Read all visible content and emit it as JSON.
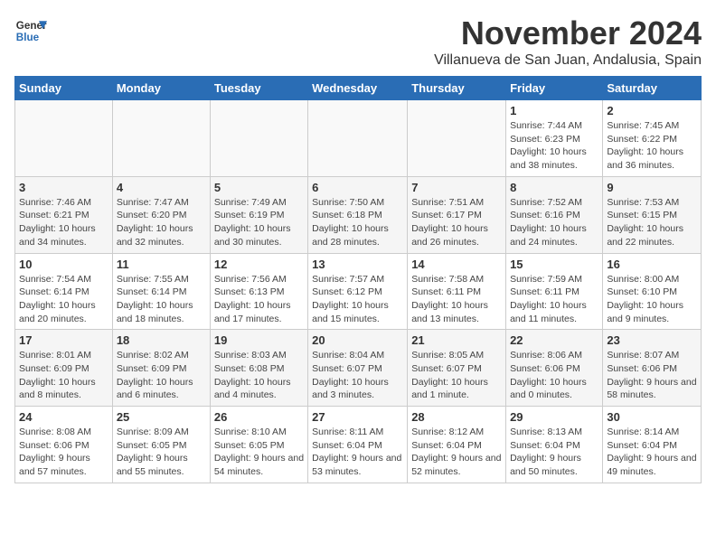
{
  "logo": {
    "line1": "General",
    "line2": "Blue"
  },
  "title": "November 2024",
  "subtitle": "Villanueva de San Juan, Andalusia, Spain",
  "columns": [
    "Sunday",
    "Monday",
    "Tuesday",
    "Wednesday",
    "Thursday",
    "Friday",
    "Saturday"
  ],
  "weeks": [
    [
      {
        "day": "",
        "info": ""
      },
      {
        "day": "",
        "info": ""
      },
      {
        "day": "",
        "info": ""
      },
      {
        "day": "",
        "info": ""
      },
      {
        "day": "",
        "info": ""
      },
      {
        "day": "1",
        "info": "Sunrise: 7:44 AM\nSunset: 6:23 PM\nDaylight: 10 hours and 38 minutes."
      },
      {
        "day": "2",
        "info": "Sunrise: 7:45 AM\nSunset: 6:22 PM\nDaylight: 10 hours and 36 minutes."
      }
    ],
    [
      {
        "day": "3",
        "info": "Sunrise: 7:46 AM\nSunset: 6:21 PM\nDaylight: 10 hours and 34 minutes."
      },
      {
        "day": "4",
        "info": "Sunrise: 7:47 AM\nSunset: 6:20 PM\nDaylight: 10 hours and 32 minutes."
      },
      {
        "day": "5",
        "info": "Sunrise: 7:49 AM\nSunset: 6:19 PM\nDaylight: 10 hours and 30 minutes."
      },
      {
        "day": "6",
        "info": "Sunrise: 7:50 AM\nSunset: 6:18 PM\nDaylight: 10 hours and 28 minutes."
      },
      {
        "day": "7",
        "info": "Sunrise: 7:51 AM\nSunset: 6:17 PM\nDaylight: 10 hours and 26 minutes."
      },
      {
        "day": "8",
        "info": "Sunrise: 7:52 AM\nSunset: 6:16 PM\nDaylight: 10 hours and 24 minutes."
      },
      {
        "day": "9",
        "info": "Sunrise: 7:53 AM\nSunset: 6:15 PM\nDaylight: 10 hours and 22 minutes."
      }
    ],
    [
      {
        "day": "10",
        "info": "Sunrise: 7:54 AM\nSunset: 6:14 PM\nDaylight: 10 hours and 20 minutes."
      },
      {
        "day": "11",
        "info": "Sunrise: 7:55 AM\nSunset: 6:14 PM\nDaylight: 10 hours and 18 minutes."
      },
      {
        "day": "12",
        "info": "Sunrise: 7:56 AM\nSunset: 6:13 PM\nDaylight: 10 hours and 17 minutes."
      },
      {
        "day": "13",
        "info": "Sunrise: 7:57 AM\nSunset: 6:12 PM\nDaylight: 10 hours and 15 minutes."
      },
      {
        "day": "14",
        "info": "Sunrise: 7:58 AM\nSunset: 6:11 PM\nDaylight: 10 hours and 13 minutes."
      },
      {
        "day": "15",
        "info": "Sunrise: 7:59 AM\nSunset: 6:11 PM\nDaylight: 10 hours and 11 minutes."
      },
      {
        "day": "16",
        "info": "Sunrise: 8:00 AM\nSunset: 6:10 PM\nDaylight: 10 hours and 9 minutes."
      }
    ],
    [
      {
        "day": "17",
        "info": "Sunrise: 8:01 AM\nSunset: 6:09 PM\nDaylight: 10 hours and 8 minutes."
      },
      {
        "day": "18",
        "info": "Sunrise: 8:02 AM\nSunset: 6:09 PM\nDaylight: 10 hours and 6 minutes."
      },
      {
        "day": "19",
        "info": "Sunrise: 8:03 AM\nSunset: 6:08 PM\nDaylight: 10 hours and 4 minutes."
      },
      {
        "day": "20",
        "info": "Sunrise: 8:04 AM\nSunset: 6:07 PM\nDaylight: 10 hours and 3 minutes."
      },
      {
        "day": "21",
        "info": "Sunrise: 8:05 AM\nSunset: 6:07 PM\nDaylight: 10 hours and 1 minute."
      },
      {
        "day": "22",
        "info": "Sunrise: 8:06 AM\nSunset: 6:06 PM\nDaylight: 10 hours and 0 minutes."
      },
      {
        "day": "23",
        "info": "Sunrise: 8:07 AM\nSunset: 6:06 PM\nDaylight: 9 hours and 58 minutes."
      }
    ],
    [
      {
        "day": "24",
        "info": "Sunrise: 8:08 AM\nSunset: 6:06 PM\nDaylight: 9 hours and 57 minutes."
      },
      {
        "day": "25",
        "info": "Sunrise: 8:09 AM\nSunset: 6:05 PM\nDaylight: 9 hours and 55 minutes."
      },
      {
        "day": "26",
        "info": "Sunrise: 8:10 AM\nSunset: 6:05 PM\nDaylight: 9 hours and 54 minutes."
      },
      {
        "day": "27",
        "info": "Sunrise: 8:11 AM\nSunset: 6:04 PM\nDaylight: 9 hours and 53 minutes."
      },
      {
        "day": "28",
        "info": "Sunrise: 8:12 AM\nSunset: 6:04 PM\nDaylight: 9 hours and 52 minutes."
      },
      {
        "day": "29",
        "info": "Sunrise: 8:13 AM\nSunset: 6:04 PM\nDaylight: 9 hours and 50 minutes."
      },
      {
        "day": "30",
        "info": "Sunrise: 8:14 AM\nSunset: 6:04 PM\nDaylight: 9 hours and 49 minutes."
      }
    ]
  ]
}
